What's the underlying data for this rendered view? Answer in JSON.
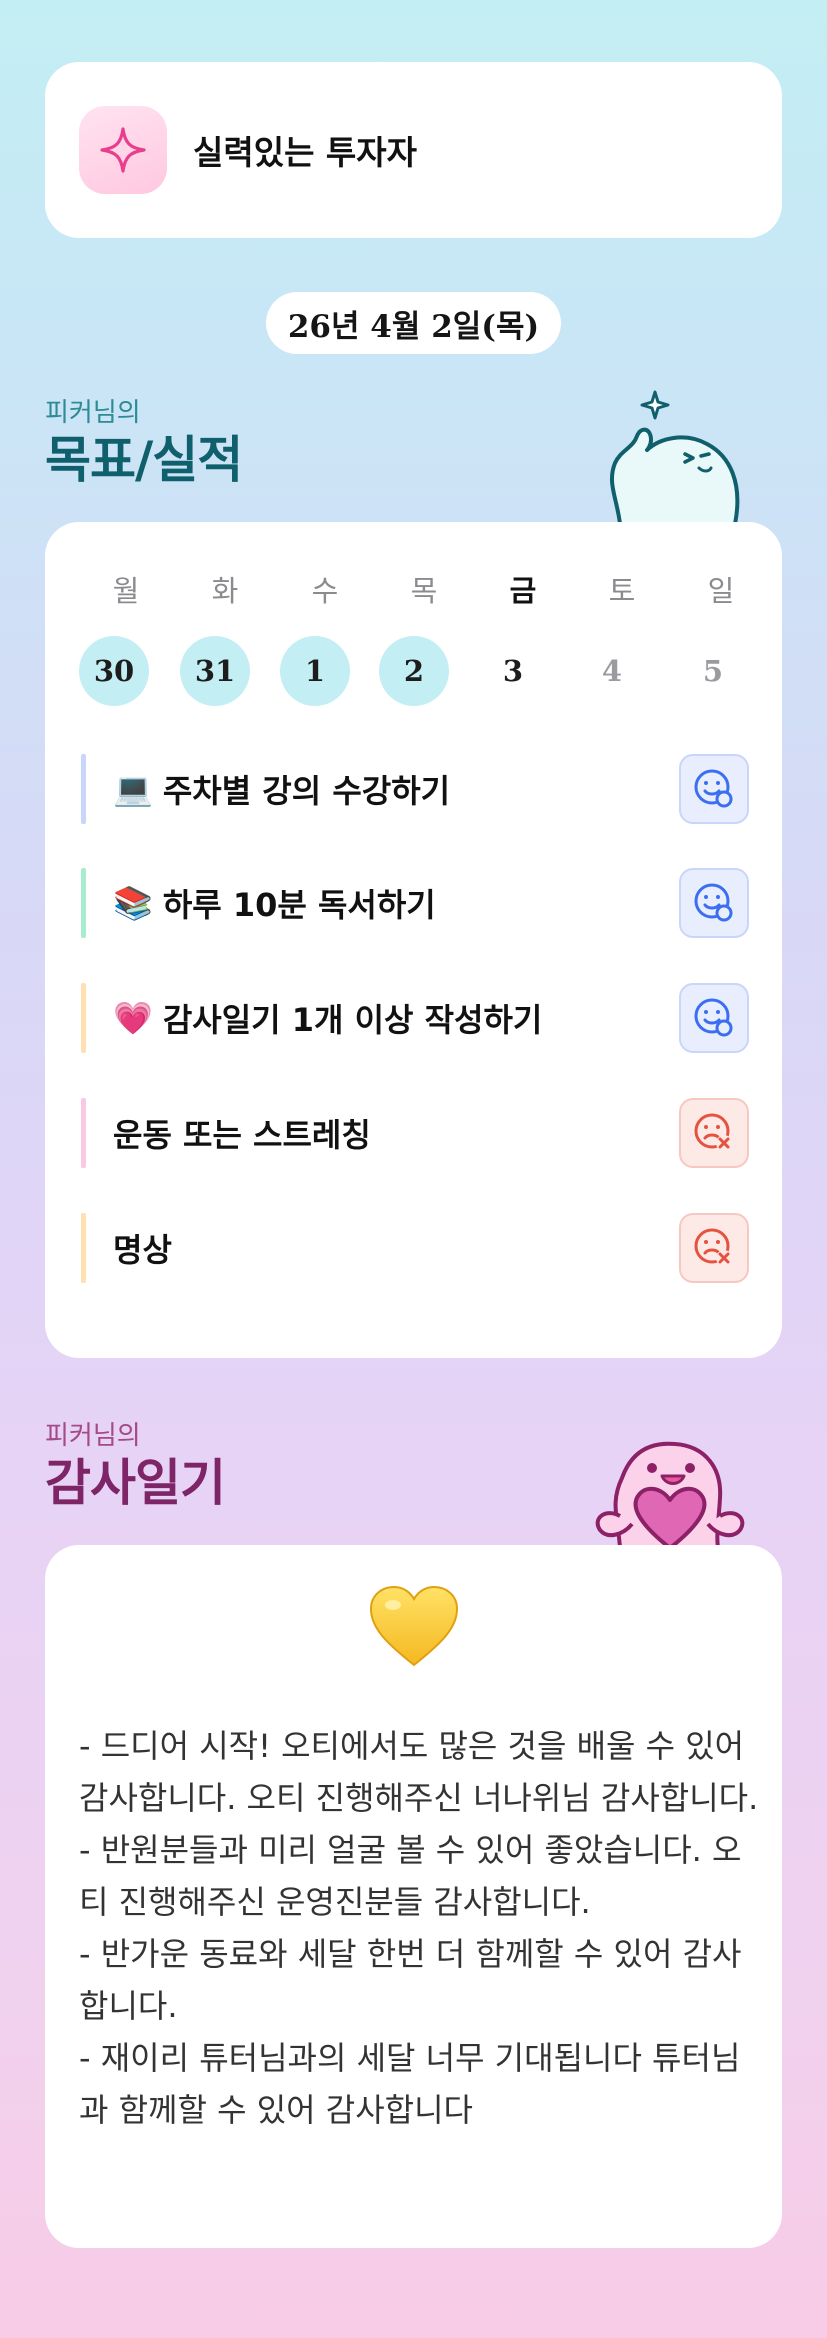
{
  "header": {
    "title": "실력있는 투자자",
    "icon": "sparkle-icon"
  },
  "date": "26년 4월 2일(목)",
  "goals_section": {
    "subtitle": "피커님의",
    "title": "목표/실적",
    "weekdays": [
      "월",
      "화",
      "수",
      "목",
      "금",
      "토",
      "일"
    ],
    "days": [
      "30",
      "31",
      "1",
      "2",
      "3",
      "4",
      "5"
    ],
    "today_weekday_index": 4,
    "completed_day_indices": [
      0,
      1,
      2,
      3
    ],
    "goals": [
      {
        "emoji": "💻",
        "label": "주차별 강의 수강하기",
        "bar_color": "#c9d6fa",
        "status": "good"
      },
      {
        "emoji": "📚",
        "label": "하루 10분 독서하기",
        "bar_color": "#a8ecd0",
        "status": "good"
      },
      {
        "emoji": "💗",
        "label": "감사일기 1개 이상 작성하기",
        "bar_color": "#ffe0b3",
        "status": "good"
      },
      {
        "emoji": "",
        "label": "운동 또는 스트레칭",
        "bar_color": "#f9c9e4",
        "status": "bad"
      },
      {
        "emoji": "",
        "label": "명상",
        "bar_color": "#ffe0b3",
        "status": "bad"
      }
    ],
    "status_icons": {
      "good": "smile-check-icon",
      "bad": "sad-x-icon"
    },
    "colors": {
      "good": "#3b6ef0",
      "bad": "#e5533f"
    }
  },
  "thanks_section": {
    "subtitle": "피커님의",
    "title": "감사일기",
    "heart_emoji": "💛",
    "text": "- 드디어 시작! 오티에서도 많은 것을 배울 수 있어 감사합니다. 오티 진행해주신 너나위님 감사합니다.\n- 반원분들과 미리 얼굴 볼 수 있어 좋았습니다. 오티 진행해주신 운영진분들 감사합니다.\n- 반가운 동료와 세달 한번 더 함께할 수 있어 감사합니다.\n- 재이리 튜터님과의 세달 너무 기대됩니다 튜터님과 함께할 수 있어 감사합니다"
  }
}
